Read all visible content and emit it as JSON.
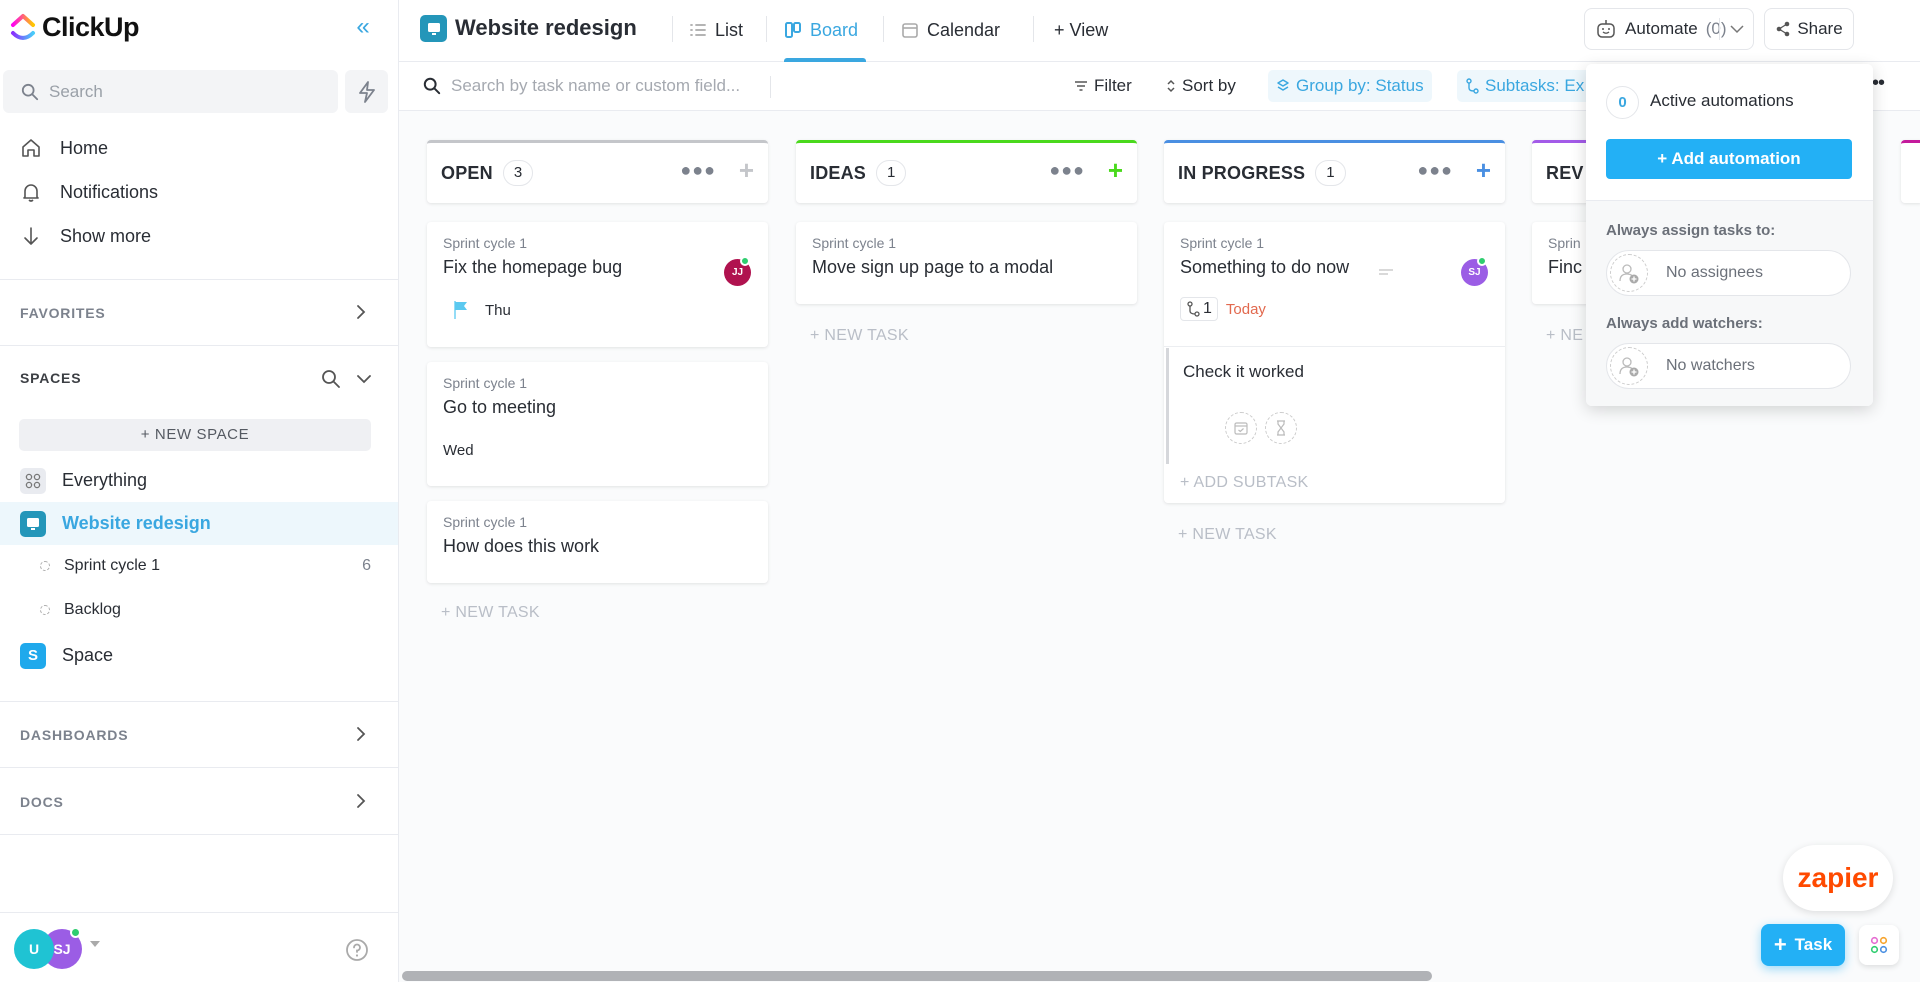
{
  "app": {
    "brand": "ClickUp",
    "accent": "#3aa7e0",
    "primary_button": "#23b0f5"
  },
  "sidebar": {
    "search_placeholder": "Search",
    "nav": [
      {
        "label": "Home",
        "icon": "home-icon"
      },
      {
        "label": "Notifications",
        "icon": "bell-icon"
      },
      {
        "label": "Show more",
        "icon": "arrow-down-icon"
      }
    ],
    "favorites_label": "FAVORITES",
    "spaces_label": "SPACES",
    "new_space_label": "+ NEW SPACE",
    "spaces": [
      {
        "label": "Everything",
        "icon": "grid-icon",
        "active": false
      },
      {
        "label": "Website redesign",
        "icon": "monitor-icon",
        "active": true,
        "color": "#2496b9"
      },
      {
        "label": "Space",
        "icon_letter": "S",
        "active": false,
        "color": "#1fa9ec"
      }
    ],
    "lists": [
      {
        "label": "Sprint cycle 1",
        "count": "6"
      },
      {
        "label": "Backlog",
        "count": ""
      }
    ],
    "dashboards_label": "DASHBOARDS",
    "docs_label": "DOCS",
    "user_avatars": [
      {
        "initials": "U",
        "color": "#1fc3d3"
      },
      {
        "initials": "SJ",
        "color": "#9b5de5"
      }
    ]
  },
  "header": {
    "project_title": "Website redesign",
    "tabs": [
      {
        "label": "List",
        "icon": "list-icon",
        "active": false
      },
      {
        "label": "Board",
        "icon": "board-icon",
        "active": true
      },
      {
        "label": "Calendar",
        "icon": "calendar-icon",
        "active": false
      }
    ],
    "add_view_label": "+ View",
    "automate_label": "Automate",
    "automate_count": "(0)",
    "share_label": "Share"
  },
  "toolbar": {
    "search_placeholder": "Search by task name or custom field...",
    "filter_label": "Filter",
    "sort_label": "Sort by",
    "group_label": "Group by: Status",
    "subtasks_label": "Subtasks: Ex"
  },
  "board": {
    "new_task_label": "+ NEW TASK",
    "add_subtask_label": "+ ADD SUBTASK",
    "columns": [
      {
        "title": "OPEN",
        "count": "3",
        "color": "#c4c6ca",
        "plus_color": "#c4c6ca",
        "cards": [
          {
            "list": "Sprint cycle 1",
            "title": "Fix the homepage bug",
            "assignee": "JJ",
            "assignee_color": "#b0124f",
            "due": "Thu",
            "flag": true
          },
          {
            "list": "Sprint cycle 1",
            "title": "Go to meeting",
            "due": "Wed"
          },
          {
            "list": "Sprint cycle 1",
            "title": "How does this work"
          }
        ]
      },
      {
        "title": "IDEAS",
        "count": "1",
        "color": "#4ad91d",
        "plus_color": "#4ad91d",
        "cards": [
          {
            "list": "Sprint cycle 1",
            "title": "Move sign up page to a modal"
          }
        ]
      },
      {
        "title": "IN PROGRESS",
        "count": "1",
        "color": "#4a8fe2",
        "plus_color": "#4a8fe2",
        "cards": [
          {
            "list": "Sprint cycle 1",
            "title": "Something to do now",
            "assignee": "SJ",
            "assignee_color": "#9b5de5",
            "subtask_count": "1",
            "due": "Today",
            "due_color": "#e2694e",
            "subtasks": [
              {
                "title": "Check it worked"
              }
            ]
          }
        ]
      },
      {
        "title": "REV",
        "color": "#a35be8",
        "cards": [
          {
            "list": "Sprin",
            "title": "Finc"
          }
        ]
      }
    ]
  },
  "automation_popup": {
    "active_count": "0",
    "active_label": "Active automations",
    "add_label": "+ Add automation",
    "assign_label": "Always assign tasks to:",
    "assign_value": "No assignees",
    "watchers_label": "Always add watchers:",
    "watchers_value": "No watchers"
  },
  "fab": {
    "zapier_label": "zapier",
    "task_label": "Task"
  }
}
